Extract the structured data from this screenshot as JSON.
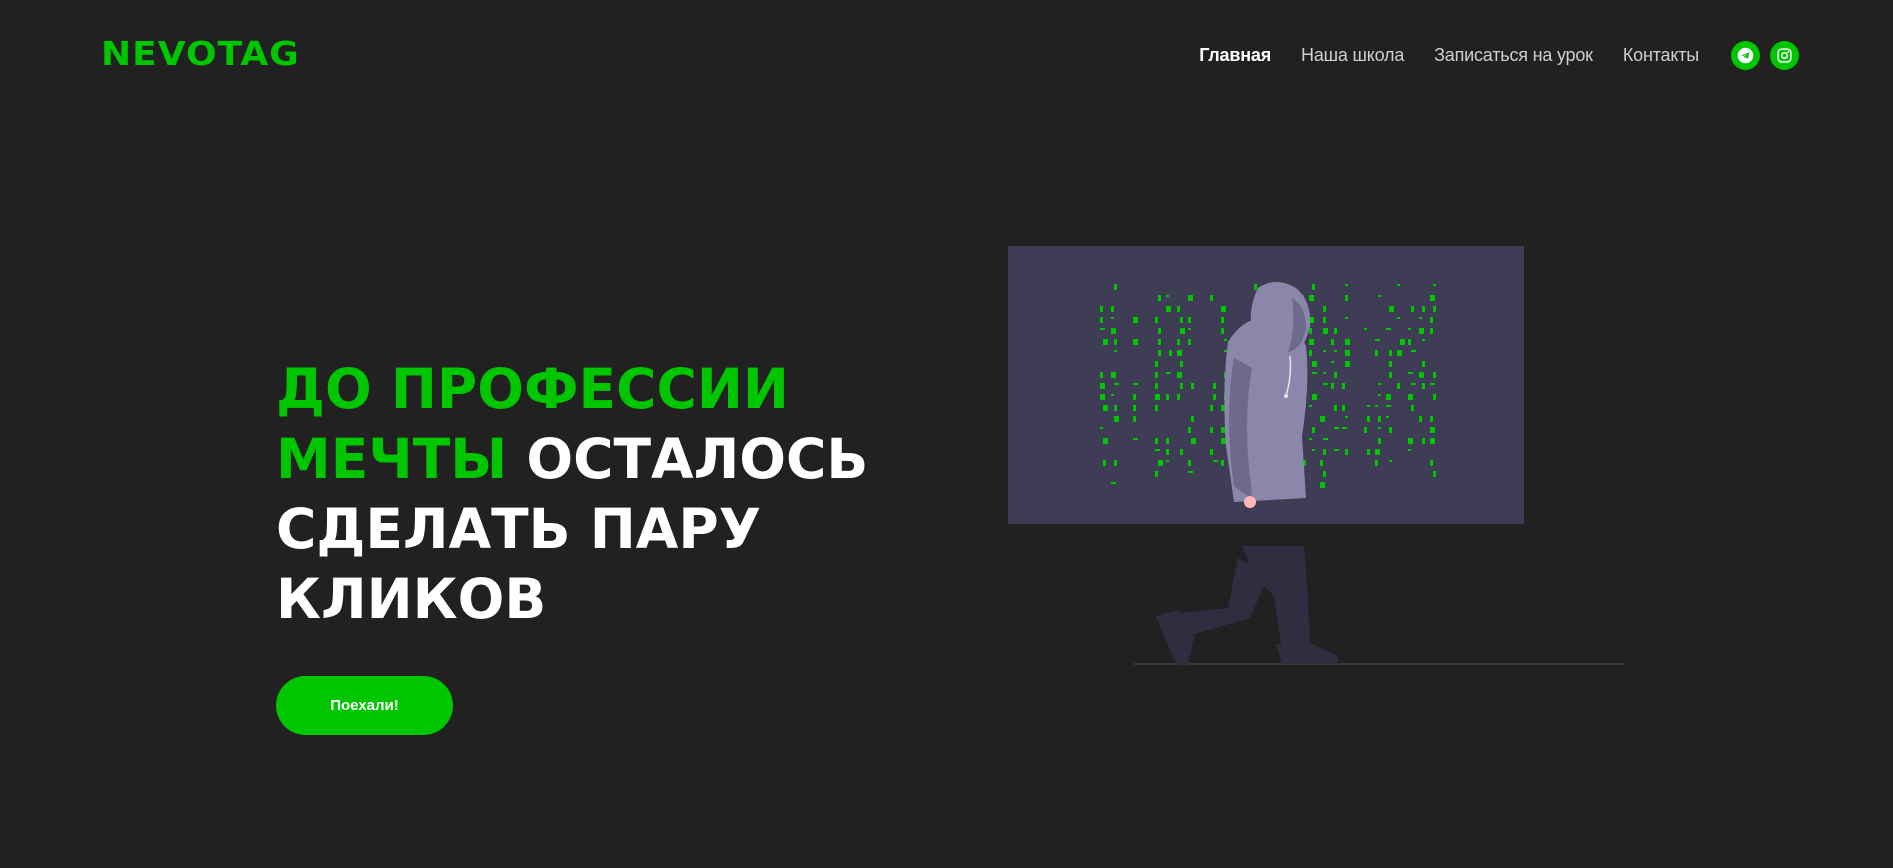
{
  "brand": {
    "name": "NEVOTAG",
    "accent_color": "#00c600"
  },
  "nav": {
    "items": [
      {
        "label": "Главная",
        "active": true
      },
      {
        "label": "Наша школа",
        "active": false
      },
      {
        "label": "Записаться на урок",
        "active": false
      },
      {
        "label": "Контакты",
        "active": false
      }
    ],
    "social": [
      {
        "icon": "telegram-icon"
      },
      {
        "icon": "instagram-icon"
      }
    ]
  },
  "hero": {
    "title_accent": "ДО ПРОФЕССИИ МЕЧТЫ",
    "title_rest": " ОСТАЛОСЬ СДЕЛАТЬ ПАРУ КЛИКОВ",
    "cta_label": "Поехали!"
  },
  "colors": {
    "background": "#212121",
    "screen": "#3f3d56",
    "hoodie": "#8a87ab",
    "pants": "#2f2e41"
  }
}
